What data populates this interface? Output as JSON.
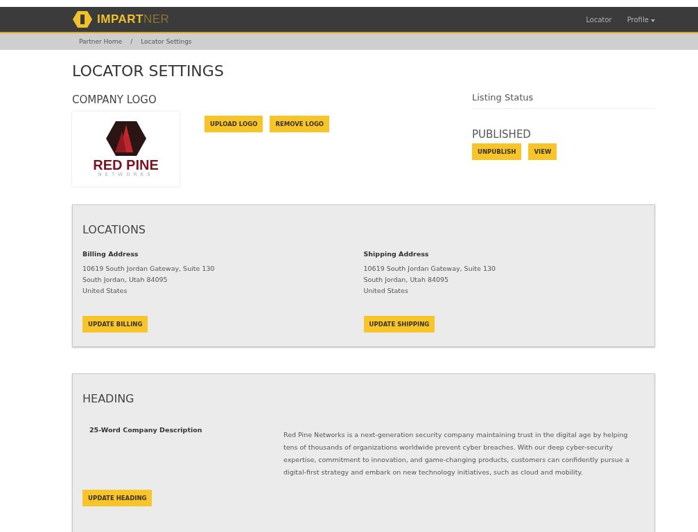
{
  "navbar": {
    "brand": {
      "main": "IMPART",
      "tail": "NER"
    },
    "links": [
      {
        "label": "Locator",
        "dropdown": false
      },
      {
        "label": "Profile",
        "dropdown": true
      }
    ]
  },
  "breadcrumb": {
    "items": [
      "Partner Home",
      "Locator Settings"
    ],
    "separator": "/"
  },
  "page_title": "LOCATOR SETTINGS",
  "company_logo": {
    "heading": "COMPANY LOGO",
    "logo_name": "RED PINE",
    "logo_tagline": "NETWORKS",
    "buttons": [
      "UPLOAD LOGO",
      "REMOVE LOGO"
    ]
  },
  "listing_status": {
    "heading": "Listing Status",
    "status": "PUBLISHED",
    "buttons": [
      "UNPUBLISH",
      "VIEW"
    ]
  },
  "locations": {
    "heading": "LOCATIONS",
    "addresses": [
      {
        "label": "Billing Address",
        "lines": [
          "10619 South Jordan Gateway, Suite 130",
          "South Jordan, Utah 84095",
          "United States"
        ],
        "button": "UPDATE BILLING"
      },
      {
        "label": "Shipping Address",
        "lines": [
          "10619 South Jordan Gateway, Suite 130",
          "South Jordan, Utah 84095",
          "United States"
        ],
        "button": "UPDATE SHIPPING"
      }
    ]
  },
  "heading_section": {
    "heading": "HEADING",
    "label": "25-Word Company Description",
    "description": "Red Pine Networks is a next-generation security company maintaining trust in the digital age by helping tens of thousands of organizations worldwide prevent cyber breaches. With our deep cyber-security expertise, commitment to innovation, and game-changing products, customers can confidently pursue a digital-first strategy and embark on new technology initiatives, such as cloud and mobility.",
    "button": "UPDATE HEADING"
  }
}
